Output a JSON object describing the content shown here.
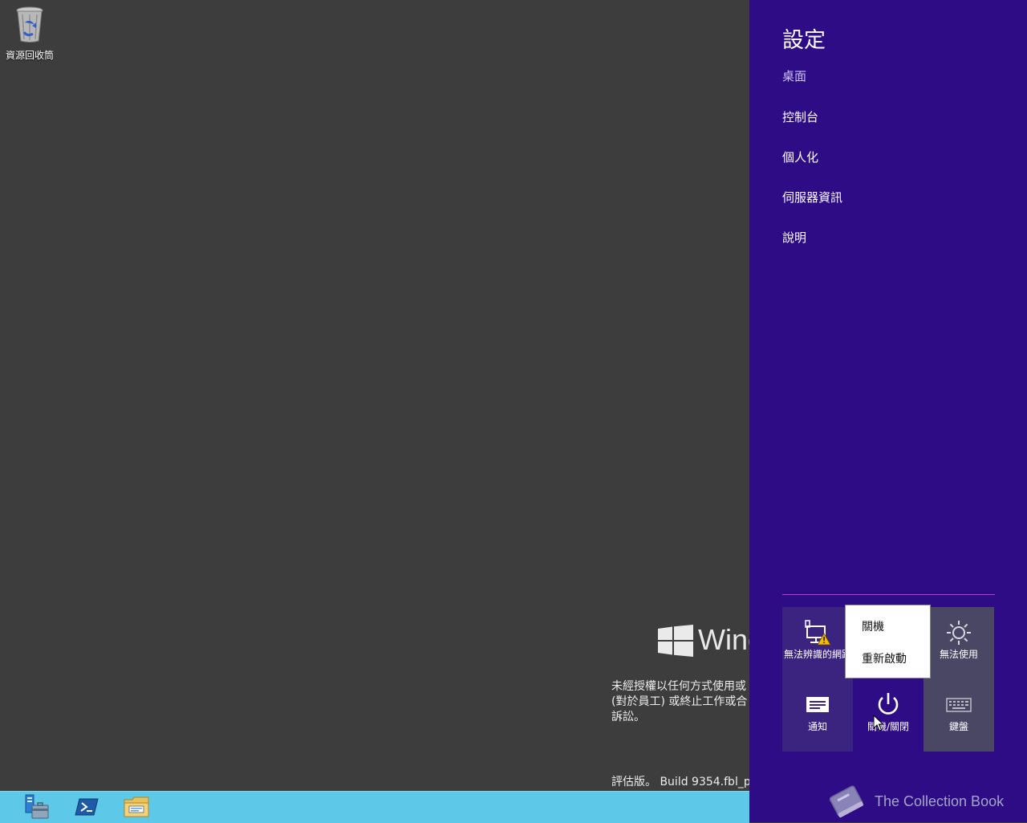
{
  "desktop": {
    "recycle_bin_label": "資源回收筒",
    "windows_brand_partial": "Winc",
    "license_notice_lines": [
      "未經授權以任何方式使用或",
      "(對於員工) 或終止工作或合",
      "訴訟。"
    ],
    "build_text": "評估版。 Build 9354.fbl_p"
  },
  "taskbar": {
    "apps": [
      "server-manager-icon",
      "powershell-icon",
      "file-explorer-icon"
    ]
  },
  "settings": {
    "title": "設定",
    "menu": [
      "桌面",
      "控制台",
      "個人化",
      "伺服器資訊",
      "說明"
    ],
    "tiles": {
      "network": "無法辨識的網路",
      "brightness": "無法使用",
      "notifications": "通知",
      "power": "關機/關閉",
      "keyboard": "鍵盤"
    },
    "power_menu": [
      "關機",
      "重新啟動"
    ]
  },
  "watermark": "The Collection Book",
  "colors": {
    "charms_bg": "#2d0c86",
    "taskbar": "#5ec8e8",
    "desktop": "#3d3d3d",
    "divider": "#b23cd8"
  }
}
